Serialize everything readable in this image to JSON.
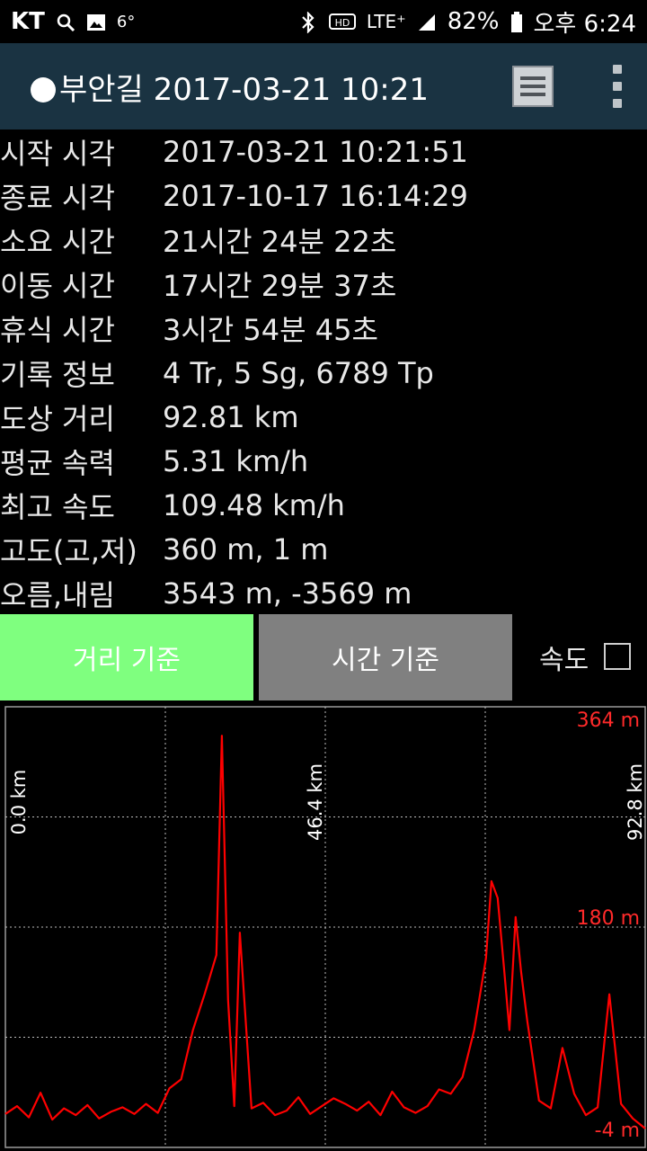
{
  "status": {
    "carrier": "KT",
    "temp": "6°",
    "network": "LTE⁺",
    "battery": "82%",
    "time": "오후 6:24"
  },
  "appbar": {
    "title": "부안길 2017-03-21 10:21"
  },
  "stats": [
    {
      "label": "시작 시각",
      "value": "2017-03-21 10:21:51"
    },
    {
      "label": "종료 시각",
      "value": "2017-10-17 16:14:29"
    },
    {
      "label": "소요 시간",
      "value": "21시간 24분 22초"
    },
    {
      "label": "이동 시간",
      "value": "17시간 29분 37초"
    },
    {
      "label": "휴식 시간",
      "value": "3시간 54분 45초"
    },
    {
      "label": "기록 정보",
      "value": "4 Tr, 5 Sg, 6789 Tp"
    },
    {
      "label": "도상 거리",
      "value": "92.81 km"
    },
    {
      "label": "평균 속력",
      "value": "5.31 km/h"
    },
    {
      "label": "최고 속도",
      "value": "109.48 km/h"
    },
    {
      "label": "고도(고,저)",
      "value": "360 m, 1 m"
    },
    {
      "label": "오름,내림",
      "value": "3543 m, -3569 m"
    }
  ],
  "controls": {
    "distance_button": "거리 기준",
    "time_button": "시간 기준",
    "speed_label": "속도",
    "speed_checked": false
  },
  "colors": {
    "appbar": "#1a3342",
    "active_button": "#7fff7f",
    "inactive_button": "#808080",
    "profile_line": "#ff0000"
  },
  "chart_data": {
    "type": "line",
    "x_unit": "km",
    "y_unit": "m",
    "xlim": [
      0.0,
      92.8
    ],
    "ylim": [
      -4,
      364
    ],
    "x_tick_labels": [
      "0.0 km",
      "46.4 km",
      "92.8 km"
    ],
    "y_tick_labels": [
      "364 m",
      "180 m",
      "-4 m"
    ],
    "grid": true,
    "series": [
      {
        "x": [
          0,
          1.7,
          3.4,
          5.1,
          6.8,
          8.5,
          10.2,
          11.9,
          13.6,
          15.3,
          17.0,
          18.7,
          20.4,
          22.1,
          23.8,
          25.5,
          27.2,
          28.9,
          30.6,
          31.4,
          32.3,
          33.2,
          34.0,
          35.7,
          37.4,
          39.1,
          40.8,
          42.5,
          44.2,
          45.9,
          47.6,
          49.3,
          51.0,
          52.7,
          54.4,
          56.1,
          57.8,
          59.5,
          61.2,
          62.9,
          64.6,
          66.3,
          68.0,
          69.7,
          70.5,
          71.4,
          72.3,
          73.1,
          74.0,
          74.8,
          75.7,
          77.4,
          79.1,
          80.8,
          82.5,
          84.2,
          85.9,
          87.6,
          89.3,
          91.0,
          92.8
        ],
        "y": [
          13,
          20,
          10,
          32,
          8,
          18,
          12,
          21,
          9,
          15,
          19,
          13,
          22,
          14,
          36,
          44,
          88,
          120,
          155,
          351,
          115,
          20,
          175,
          18,
          23,
          12,
          16,
          28,
          13,
          20,
          27,
          22,
          16,
          24,
          12,
          33,
          19,
          14,
          20,
          35,
          31,
          46,
          88,
          152,
          221,
          206,
          145,
          88,
          189,
          140,
          96,
          25,
          18,
          72,
          31,
          12,
          19,
          120,
          22,
          9,
          0
        ]
      }
    ]
  }
}
